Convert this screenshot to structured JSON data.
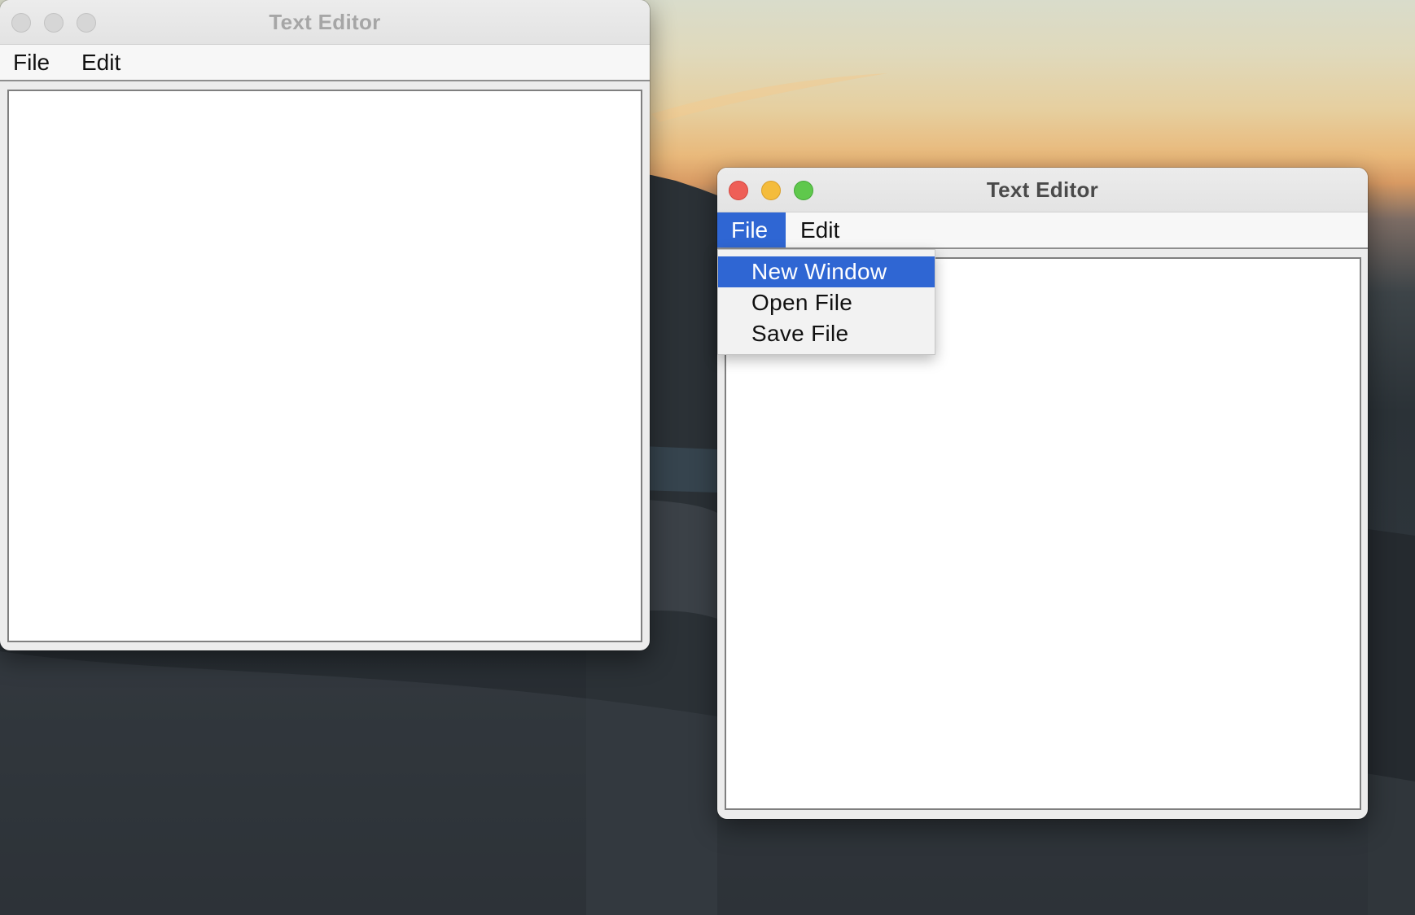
{
  "windows": [
    {
      "title": "Text Editor",
      "menus": [
        "File",
        "Edit"
      ],
      "state": "inactive",
      "text_content": ""
    },
    {
      "title": "Text Editor",
      "menus": [
        "File",
        "Edit"
      ],
      "state": "active",
      "open_menu": "File",
      "text_content": ""
    }
  ],
  "file_menu": {
    "items": [
      "New Window",
      "Open File",
      "Save File"
    ],
    "highlighted": "New Window"
  },
  "colors": {
    "selection": "#2f66d3",
    "close": "#ee5f57",
    "minimize": "#f4bc3c",
    "zoom": "#5fc84c"
  },
  "icons": [
    "close-icon",
    "minimize-icon",
    "zoom-icon"
  ]
}
